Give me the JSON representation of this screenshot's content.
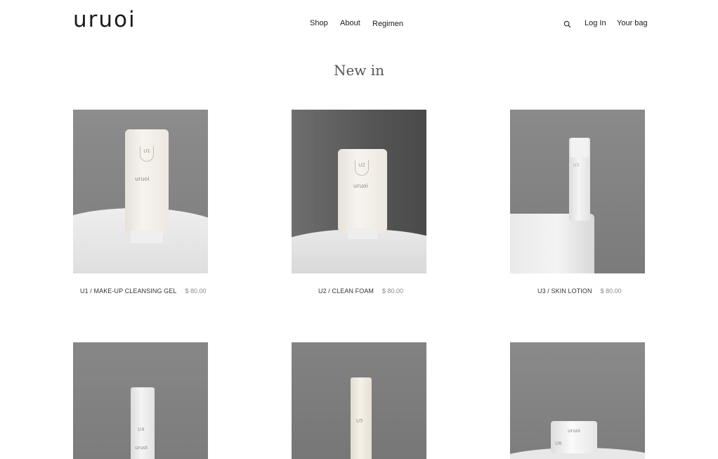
{
  "header": {
    "logo": "uruoi",
    "nav": [
      "Shop",
      "About",
      "Regimen"
    ],
    "search_icon": "search-icon",
    "login": "Log In",
    "bag": "Your bag"
  },
  "section": {
    "title": "New in"
  },
  "products": [
    {
      "name": "U1 / MAKE-UP CLEANSING GEL",
      "price": "$ 80.00",
      "badge": "U1"
    },
    {
      "name": "U2 / CLEAN FOAM",
      "price": "$ 80.00",
      "badge": "U2"
    },
    {
      "name": "U3 / SKIN LOTION",
      "price": "$ 80.00",
      "badge": "U3"
    },
    {
      "name": "",
      "price": "",
      "badge": "U4"
    },
    {
      "name": "",
      "price": "",
      "badge": "U5"
    },
    {
      "name": "",
      "price": "",
      "badge": "U6"
    }
  ],
  "colors": {
    "photo_bg": "#7a7a7a",
    "text": "#1a1a1a",
    "price": "#8a8a8a"
  }
}
